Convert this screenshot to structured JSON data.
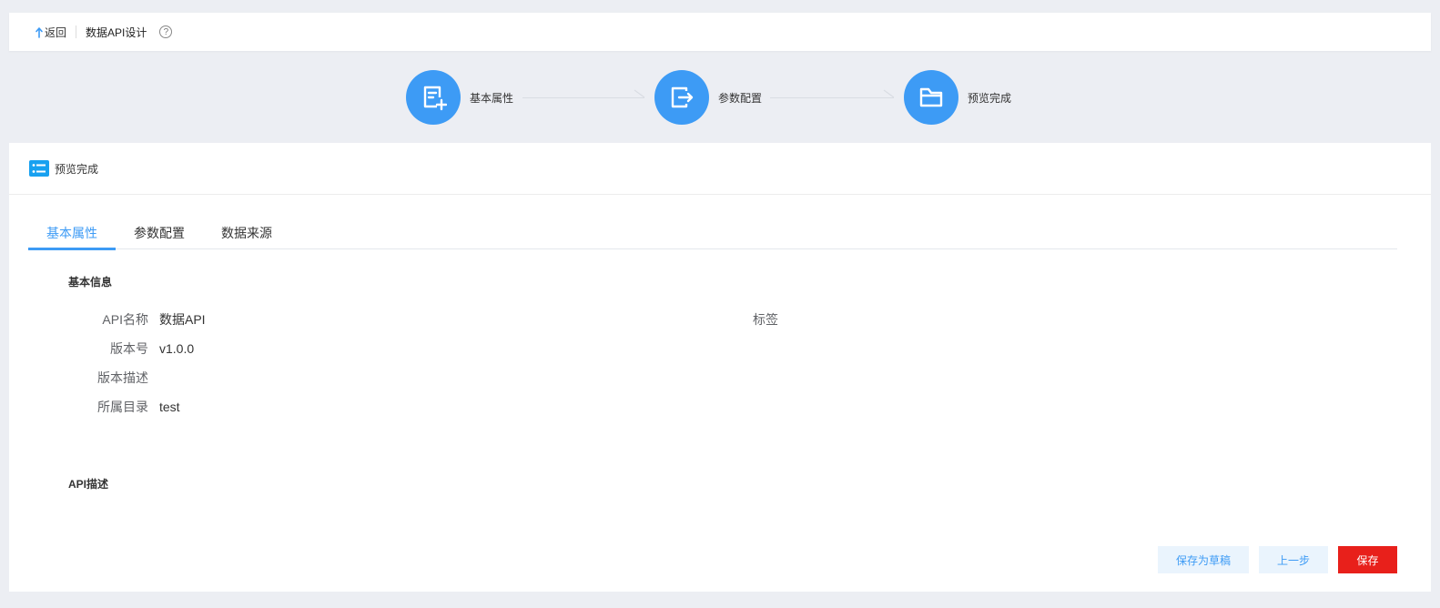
{
  "topbar": {
    "back_label": "返回",
    "title": "数据API设计",
    "help_glyph": "?",
    "icons": {
      "back": "arrow-up-back-icon",
      "help": "question-circle-icon"
    }
  },
  "steps": [
    {
      "label": "基本属性",
      "icon": "document-add-icon"
    },
    {
      "label": "参数配置",
      "icon": "export-icon"
    },
    {
      "label": "预览完成",
      "icon": "folder-icon"
    }
  ],
  "colors": {
    "primary": "#3d9bf5",
    "danger": "#e8201b",
    "light_button_bg": "#eaf4fd",
    "background": "#eceef3"
  },
  "card": {
    "header_title": "预览完成",
    "header_icon": "list-icon",
    "tabs": [
      {
        "label": "基本属性",
        "active": true
      },
      {
        "label": "参数配置",
        "active": false
      },
      {
        "label": "数据来源",
        "active": false
      }
    ],
    "basic_info": {
      "title": "基本信息",
      "fields": [
        {
          "label": "API名称",
          "value": "数据API"
        },
        {
          "label": "版本号",
          "value": "v1.0.0"
        },
        {
          "label": "版本描述",
          "value": ""
        },
        {
          "label": "所属目录",
          "value": "test"
        }
      ],
      "tag_label": "标签",
      "tag_value": ""
    },
    "api_desc": {
      "title": "API描述"
    },
    "buttons": {
      "save_draft": "保存为草稿",
      "prev_step": "上一步",
      "save": "保存"
    }
  }
}
